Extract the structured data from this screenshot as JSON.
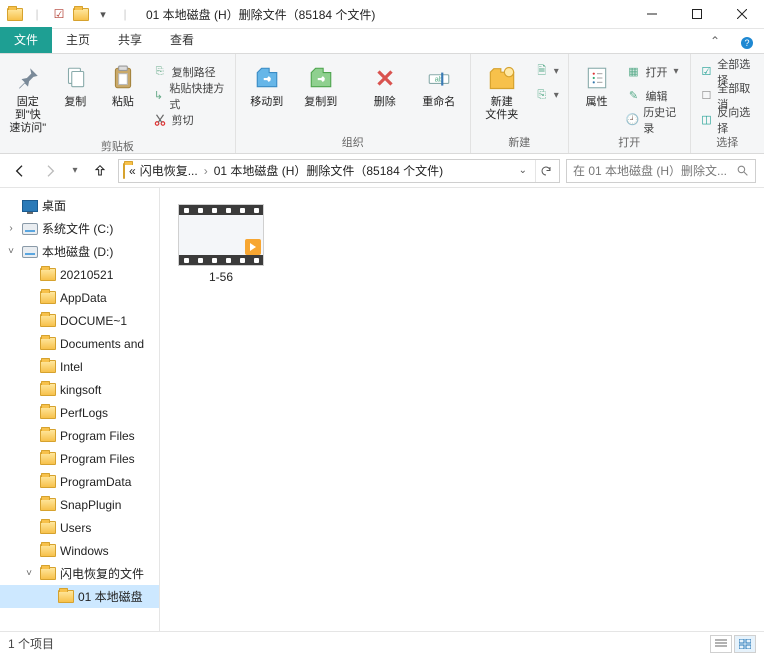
{
  "window": {
    "title": "01 本地磁盘 (H）删除文件（85184 个文件)"
  },
  "tabs": {
    "file": "文件",
    "home": "主页",
    "share": "共享",
    "view": "查看"
  },
  "ribbon": {
    "pin": {
      "label": "固定到\"快\n速访问\""
    },
    "copy": "复制",
    "paste": "粘贴",
    "copy_path": "复制路径",
    "paste_shortcut": "粘贴快捷方式",
    "cut": "剪切",
    "group_clipboard": "剪贴板",
    "move_to": "移动到",
    "copy_to": "复制到",
    "delete": "删除",
    "rename": "重命名",
    "group_organize": "组织",
    "new_folder": "新建\n文件夹",
    "group_new": "新建",
    "properties": "属性",
    "open": "打开",
    "edit": "编辑",
    "history": "历史记录",
    "group_open": "打开",
    "select_all": "全部选择",
    "select_none": "全部取消",
    "invert_sel": "反向选择",
    "group_select": "选择"
  },
  "breadcrumb": {
    "root_glyph": "«",
    "seg1": "闪电恢复...",
    "seg2": "01 本地磁盘 (H）删除文件（85184 个文件)"
  },
  "search": {
    "placeholder": "在 01 本地磁盘 (H）删除文..."
  },
  "tree": [
    {
      "indent": 0,
      "icon": "desktop",
      "label": "桌面"
    },
    {
      "indent": 0,
      "icon": "drive",
      "label": "系统文件 (C:)",
      "tw": "›"
    },
    {
      "indent": 0,
      "icon": "drive",
      "label": "本地磁盘 (D:)",
      "tw": "˅"
    },
    {
      "indent": 1,
      "icon": "folder",
      "label": "20210521"
    },
    {
      "indent": 1,
      "icon": "folder",
      "label": "AppData"
    },
    {
      "indent": 1,
      "icon": "folder",
      "label": "DOCUME~1"
    },
    {
      "indent": 1,
      "icon": "folder",
      "label": "Documents and",
      "doc": true
    },
    {
      "indent": 1,
      "icon": "folder",
      "label": "Intel"
    },
    {
      "indent": 1,
      "icon": "folder",
      "label": "kingsoft"
    },
    {
      "indent": 1,
      "icon": "folder",
      "label": "PerfLogs"
    },
    {
      "indent": 1,
      "icon": "folder",
      "label": "Program Files"
    },
    {
      "indent": 1,
      "icon": "folder",
      "label": "Program Files"
    },
    {
      "indent": 1,
      "icon": "folder",
      "label": "ProgramData"
    },
    {
      "indent": 1,
      "icon": "folder",
      "label": "SnapPlugin"
    },
    {
      "indent": 1,
      "icon": "folder",
      "label": "Users"
    },
    {
      "indent": 1,
      "icon": "folder",
      "label": "Windows"
    },
    {
      "indent": 1,
      "icon": "folder",
      "label": "闪电恢复的文件",
      "tw": "˅"
    },
    {
      "indent": 2,
      "icon": "folder",
      "label": "01 本地磁盘",
      "sel": true
    }
  ],
  "files": [
    {
      "name": "1-56",
      "type": "video"
    }
  ],
  "status": {
    "text": "1 个项目"
  }
}
